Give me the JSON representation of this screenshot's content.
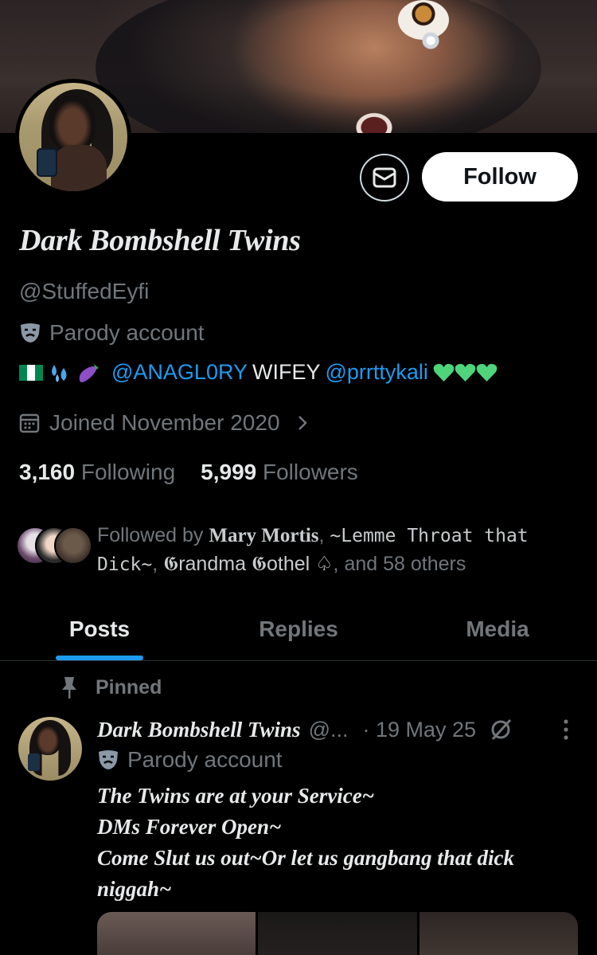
{
  "profile": {
    "display_name": "Dark Bombshell Twins",
    "handle": "@StuffedEyfi",
    "parody_label": "Parody account",
    "bio": {
      "link1": "@ANAGL0RY",
      "word": "WIFEY",
      "link2": "@prrttykali"
    },
    "joined": "Joined November 2020",
    "following_count": "3,160",
    "following_label": "Following",
    "followers_count": "5,999",
    "followers_label": "Followers",
    "follow_button": "Follow",
    "followed_by": {
      "prefix": "Followed by ",
      "name1": "Mary Mortis",
      "sep1": ", ",
      "name2": "~Lemme Throat that Dick~",
      "sep2": ", ",
      "name3": "𝕲randma 𝕲othel ♤",
      "suffix": ", and 58 others"
    }
  },
  "tabs": [
    "Posts",
    "Replies",
    "Media"
  ],
  "pinned_label": "Pinned",
  "post": {
    "name": "Dark Bombshell Twins",
    "handle": "@...",
    "date": "· 19 May 25",
    "parody_label": "Parody account",
    "lines": [
      "The Twins are at your Service~",
      "DMs Forever Open~",
      "Come Slut us out~Or let us gangbang that dick",
      "niggah~"
    ]
  },
  "colors": {
    "accent": "#1d9bf0",
    "muted": "#71767b",
    "text": "#e7e9ea",
    "heart": "#4fd47b",
    "flag_green": "#008751"
  },
  "icons": [
    "mail-icon",
    "theater-mask-icon",
    "nigeria-flag-icon",
    "sweat-drops-icon",
    "eggplant-icon",
    "green-heart-icon",
    "calendar-icon",
    "chevron-right-icon",
    "pin-icon",
    "grok-icon",
    "more-icon"
  ]
}
